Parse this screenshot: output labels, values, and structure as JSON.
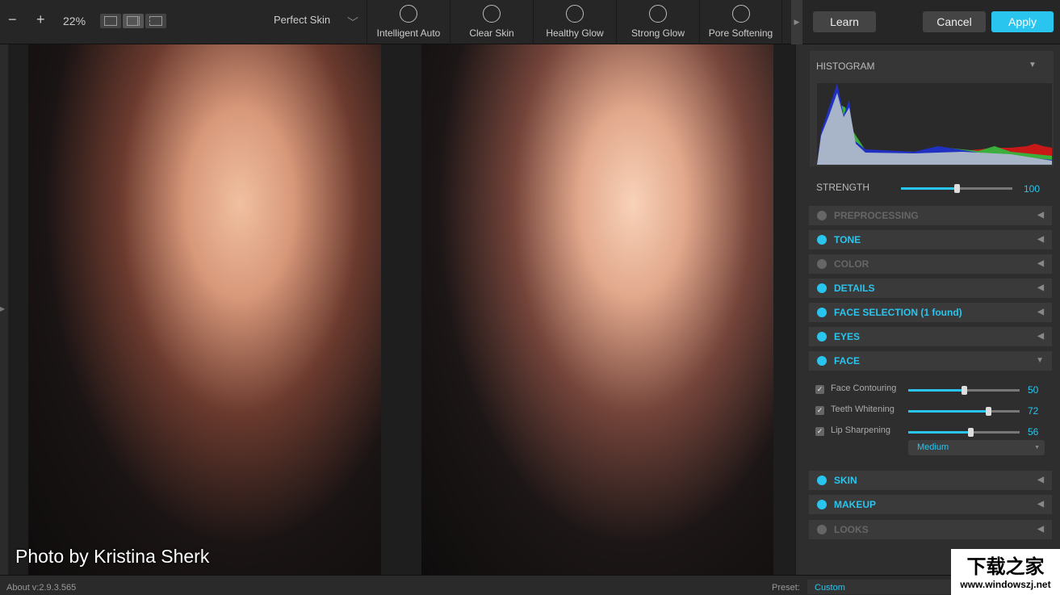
{
  "toolbar": {
    "zoom": "22%",
    "preset_name": "Perfect Skin",
    "presets": [
      {
        "label": "Intelligent Auto",
        "icon": "face-auto-icon"
      },
      {
        "label": "Clear Skin",
        "icon": "face-icon"
      },
      {
        "label": "Healthy Glow",
        "icon": "glow-face-icon"
      },
      {
        "label": "Strong Glow",
        "icon": "strong-glow-icon"
      },
      {
        "label": "Pore Softening",
        "icon": "pore-icon"
      }
    ],
    "learn": "Learn",
    "cancel": "Cancel",
    "apply": "Apply"
  },
  "photo": {
    "credit": "Photo by Kristina Sherk"
  },
  "panel": {
    "histogram_title": "HISTOGRAM",
    "strength_label": "STRENGTH",
    "strength_value": "100",
    "strength": 100,
    "sections": [
      "PREPROCESSING",
      "TONE",
      "COLOR",
      "DETAILS",
      "FACE SELECTION (1 found)",
      "EYES",
      "FACE",
      "SKIN",
      "MAKEUP",
      "LOOKS"
    ],
    "face": {
      "controls": [
        {
          "label": "Face Contouring",
          "value": "50",
          "pct": 50
        },
        {
          "label": "Teeth Whitening",
          "value": "72",
          "pct": 72
        },
        {
          "label": "Lip Sharpening",
          "value": "56",
          "pct": 56
        }
      ],
      "lip_mode": "Medium"
    }
  },
  "status": {
    "version": "About v:2.9.3.565",
    "preset_label": "Preset:",
    "preset_value": "Custom"
  },
  "watermark": {
    "title": "下载之家",
    "url": "www.windowszj.net"
  },
  "colors": {
    "accent": "#29c5ef"
  }
}
